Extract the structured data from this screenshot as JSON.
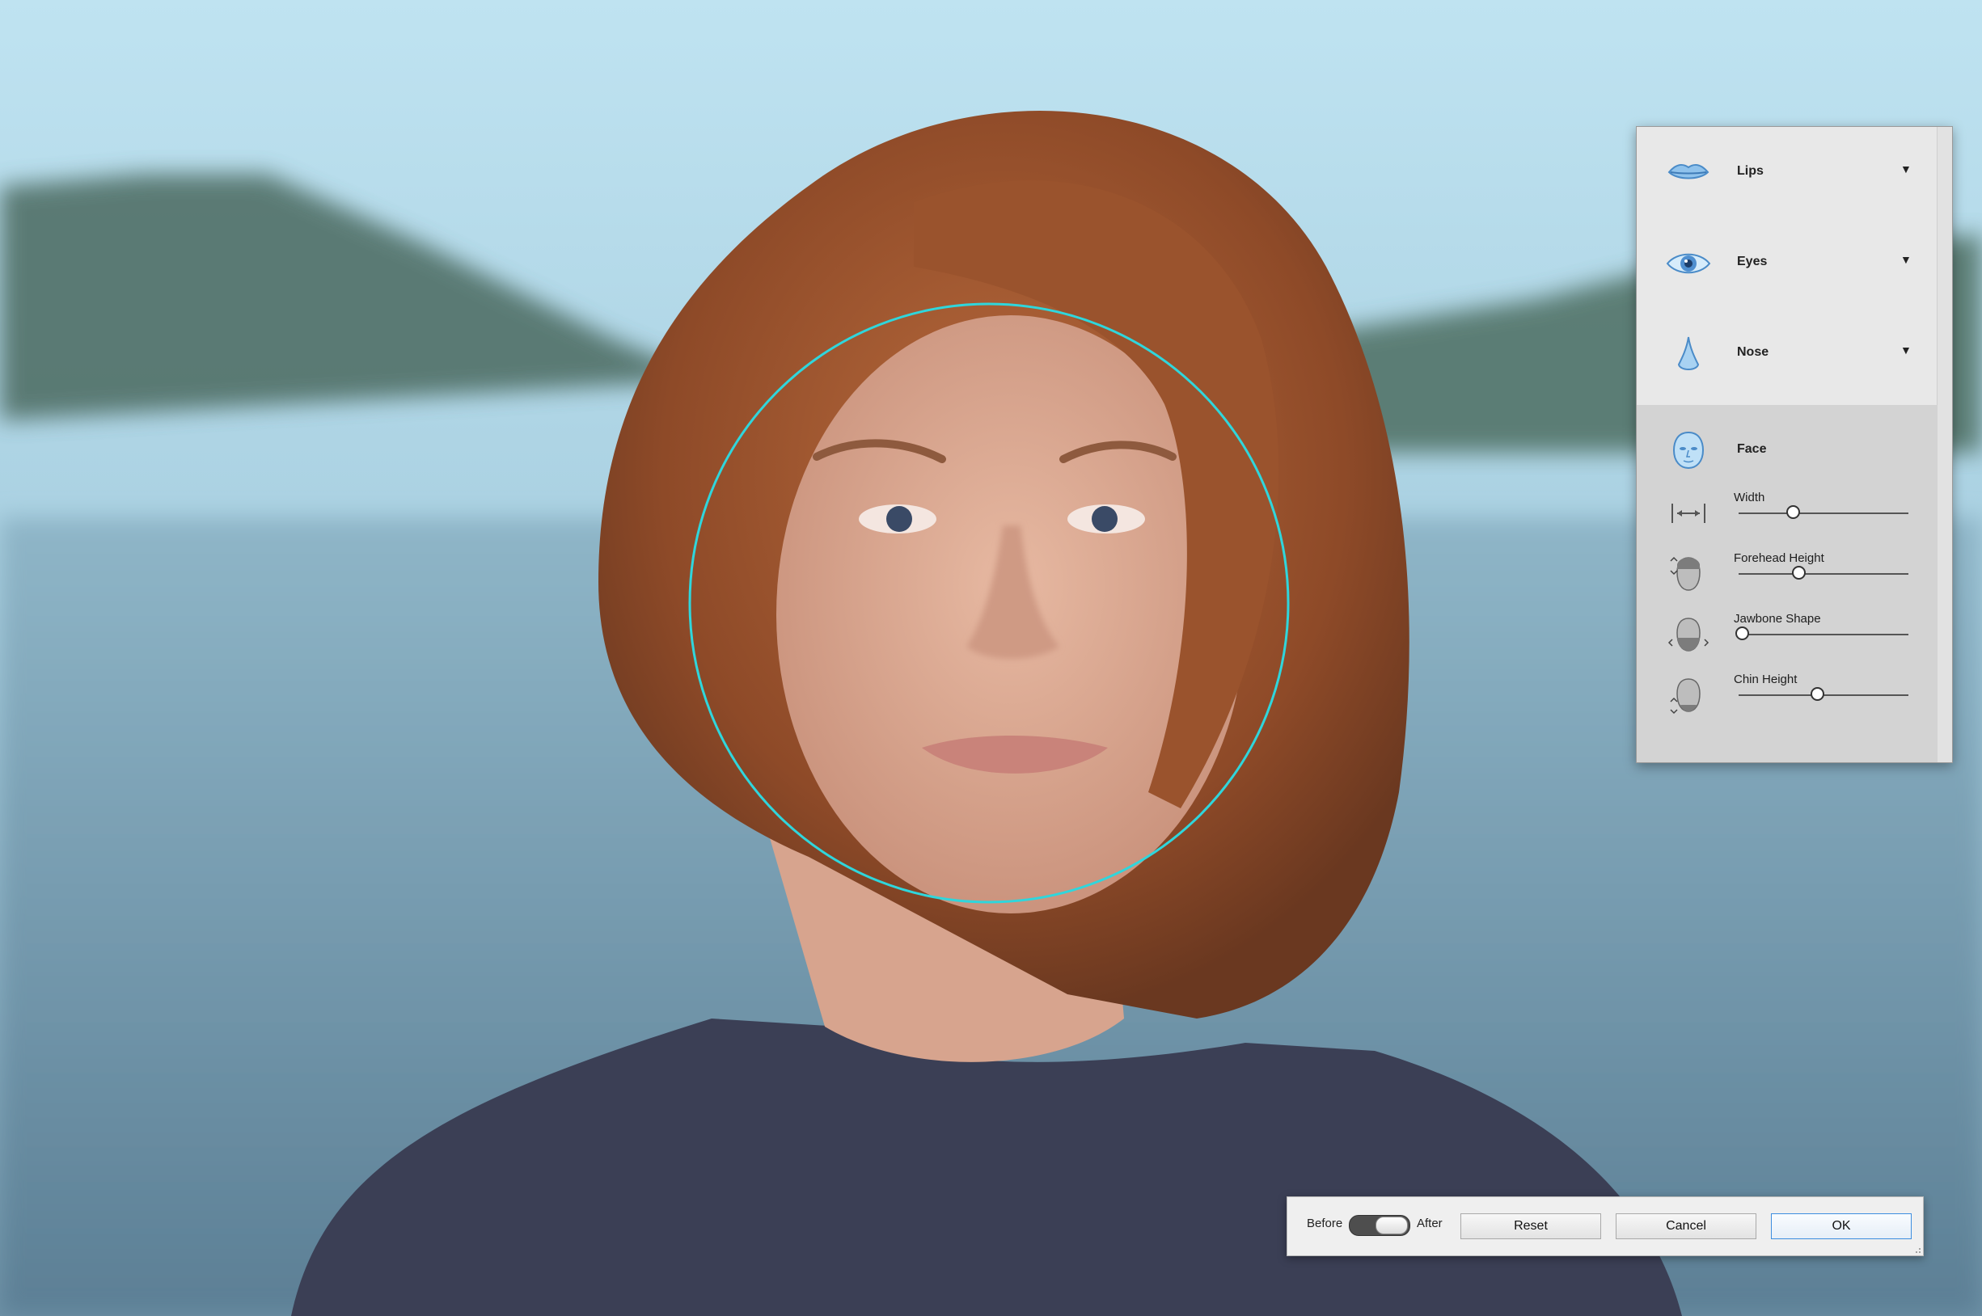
{
  "panel": {
    "sections": [
      {
        "key": "lips",
        "label": "Lips",
        "icon": "lips-icon",
        "arrow": "▼"
      },
      {
        "key": "eyes",
        "label": "Eyes",
        "icon": "eye-icon",
        "arrow": "▼"
      },
      {
        "key": "nose",
        "label": "Nose",
        "icon": "nose-icon",
        "arrow": "▼"
      }
    ],
    "face": {
      "label": "Face",
      "icon": "face-icon",
      "sliders": [
        {
          "label": "Width",
          "icon": "width-arrows-icon",
          "value": 0.32
        },
        {
          "label": "Forehead Height",
          "icon": "forehead-height-icon",
          "value": 0.35
        },
        {
          "label": "Jawbone Shape",
          "icon": "jawbone-shape-icon",
          "value": 0.02
        },
        {
          "label": "Chin Height",
          "icon": "chin-height-icon",
          "value": 0.46
        }
      ]
    }
  },
  "bar": {
    "before_label": "Before",
    "after_label": "After",
    "toggle_state": "after",
    "reset_label": "Reset",
    "cancel_label": "Cancel",
    "ok_label": "OK"
  },
  "colors": {
    "selection_circle": "#2fd6dc",
    "panel_bg": "#e8e8e8",
    "face_block_bg": "#d3d3d3",
    "ok_border": "#3d8ee0"
  }
}
